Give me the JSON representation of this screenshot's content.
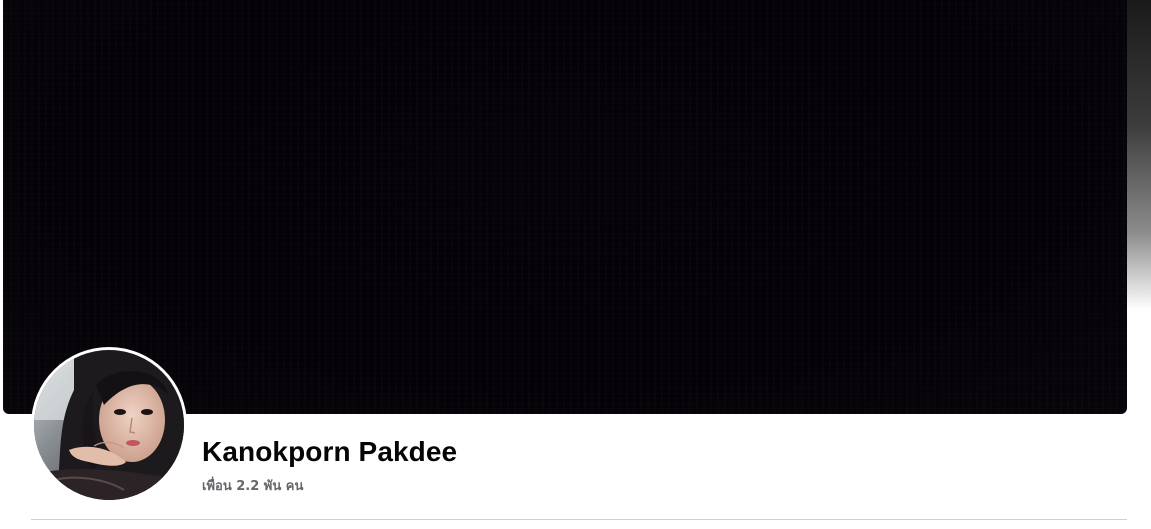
{
  "profile": {
    "name": "Kanokporn Pakdee",
    "friends_text": "เพื่อน 2.2 พัน คน"
  },
  "cover": {
    "description_color": "#040207"
  },
  "colors": {
    "name_text": "#050505",
    "secondary_text": "#65676b",
    "divider": "#ced0d4"
  }
}
